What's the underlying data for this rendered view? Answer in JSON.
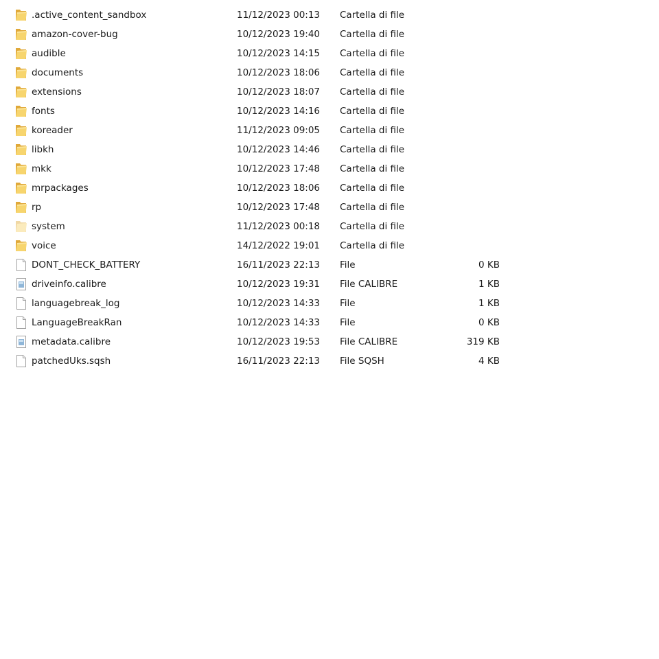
{
  "items": [
    {
      "name": ".active_content_sandbox",
      "date": "11/12/2023 00:13",
      "type": "Cartella di file",
      "size": "",
      "icon": "folder-icon"
    },
    {
      "name": "amazon-cover-bug",
      "date": "10/12/2023 19:40",
      "type": "Cartella di file",
      "size": "",
      "icon": "folder-icon"
    },
    {
      "name": "audible",
      "date": "10/12/2023 14:15",
      "type": "Cartella di file",
      "size": "",
      "icon": "folder-icon"
    },
    {
      "name": "documents",
      "date": "10/12/2023 18:06",
      "type": "Cartella di file",
      "size": "",
      "icon": "folder-icon"
    },
    {
      "name": "extensions",
      "date": "10/12/2023 18:07",
      "type": "Cartella di file",
      "size": "",
      "icon": "folder-icon"
    },
    {
      "name": "fonts",
      "date": "10/12/2023 14:16",
      "type": "Cartella di file",
      "size": "",
      "icon": "folder-icon"
    },
    {
      "name": "koreader",
      "date": "11/12/2023 09:05",
      "type": "Cartella di file",
      "size": "",
      "icon": "folder-icon"
    },
    {
      "name": "libkh",
      "date": "10/12/2023 14:46",
      "type": "Cartella di file",
      "size": "",
      "icon": "folder-icon"
    },
    {
      "name": "mkk",
      "date": "10/12/2023 17:48",
      "type": "Cartella di file",
      "size": "",
      "icon": "folder-icon"
    },
    {
      "name": "mrpackages",
      "date": "10/12/2023 18:06",
      "type": "Cartella di file",
      "size": "",
      "icon": "folder-icon"
    },
    {
      "name": "rp",
      "date": "10/12/2023 17:48",
      "type": "Cartella di file",
      "size": "",
      "icon": "folder-icon"
    },
    {
      "name": "system",
      "date": "11/12/2023 00:18",
      "type": "Cartella di file",
      "size": "",
      "icon": "hidden-folder-icon"
    },
    {
      "name": "voice",
      "date": "14/12/2022 19:01",
      "type": "Cartella di file",
      "size": "",
      "icon": "folder-icon"
    },
    {
      "name": "DONT_CHECK_BATTERY",
      "date": "16/11/2023 22:13",
      "type": "File",
      "size": "0 KB",
      "icon": "file-icon"
    },
    {
      "name": "driveinfo.calibre",
      "date": "10/12/2023 19:31",
      "type": "File CALIBRE",
      "size": "1 KB",
      "icon": "calibre-file-icon"
    },
    {
      "name": "languagebreak_log",
      "date": "10/12/2023 14:33",
      "type": "File",
      "size": "1 KB",
      "icon": "file-icon"
    },
    {
      "name": "LanguageBreakRan",
      "date": "10/12/2023 14:33",
      "type": "File",
      "size": "0 KB",
      "icon": "file-icon"
    },
    {
      "name": "metadata.calibre",
      "date": "10/12/2023 19:53",
      "type": "File CALIBRE",
      "size": "319 KB",
      "icon": "calibre-file-icon"
    },
    {
      "name": "patchedUks.sqsh",
      "date": "16/11/2023 22:13",
      "type": "File SQSH",
      "size": "4 KB",
      "icon": "file-icon"
    }
  ],
  "colors": {
    "folder_back": "#E8B845",
    "folder_front": "#F7D56E",
    "file_border": "#9A9A9A",
    "text": "#1a1a1a"
  }
}
